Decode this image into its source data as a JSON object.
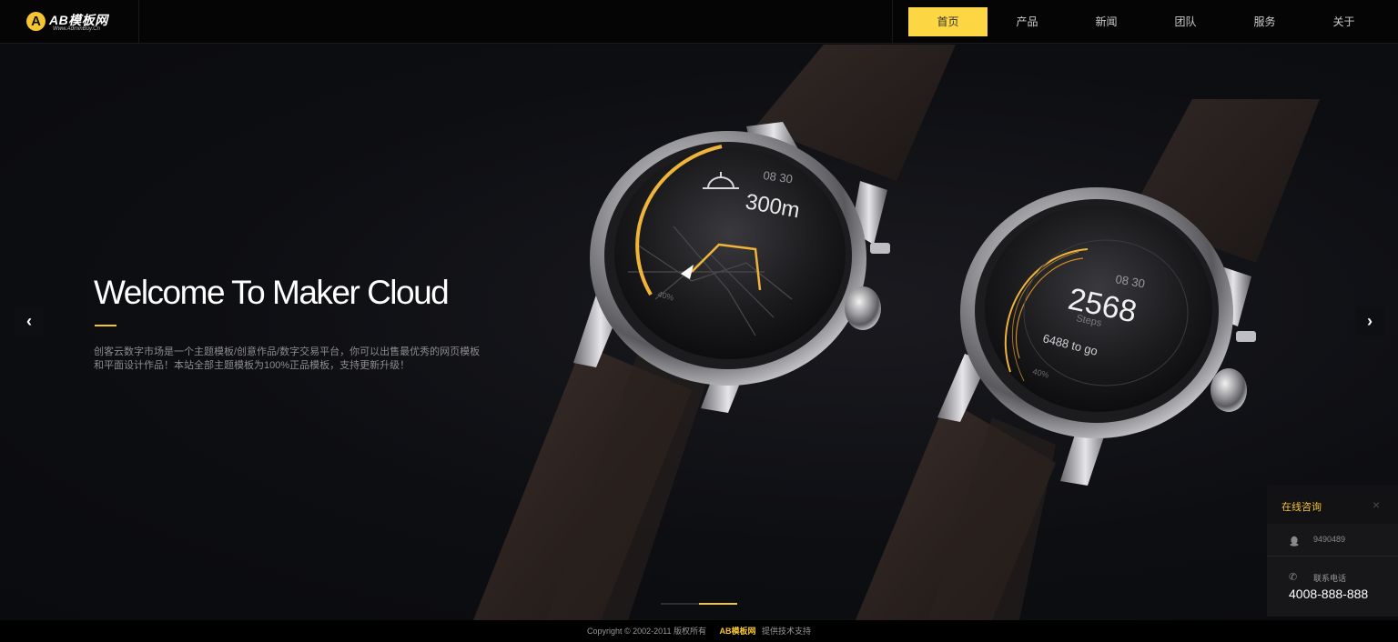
{
  "header": {
    "logo_text": "AB模板网",
    "logo_sub": "Www.AdminBuy.Cn",
    "nav": [
      "首页",
      "产品",
      "新闻",
      "团队",
      "服务",
      "关于"
    ],
    "active_nav": "首页"
  },
  "hero": {
    "title": "Welcome To Maker Cloud",
    "description": "创客云数字市场是一个主题模板/创意作品/数字交易平台，你可以出售最优秀的网页模板和平面设计作品！本站全部主题模板为100%正品模板，支持更新升级！",
    "prev_label": "‹",
    "next_label": "›",
    "slide_count": 2,
    "active_slide": 2
  },
  "watch_left": {
    "time": "08 30",
    "distance": "300m",
    "percent": "40%"
  },
  "watch_right": {
    "time": "08 30",
    "steps": "2568",
    "steps_label": "Steps",
    "to_go": "6488 to go",
    "percent": "40%"
  },
  "chat": {
    "title": "在线咨询",
    "close": "×",
    "qq": "9490489",
    "phone_label": "联系电话",
    "phone": "4008-888-888"
  },
  "footer": {
    "copyright": "Copyright © 2002-2011 版权所有",
    "brand": "AB模板网",
    "support": "提供技术支持"
  },
  "colors": {
    "accent": "#fdd643",
    "background": "#0b0c10"
  }
}
